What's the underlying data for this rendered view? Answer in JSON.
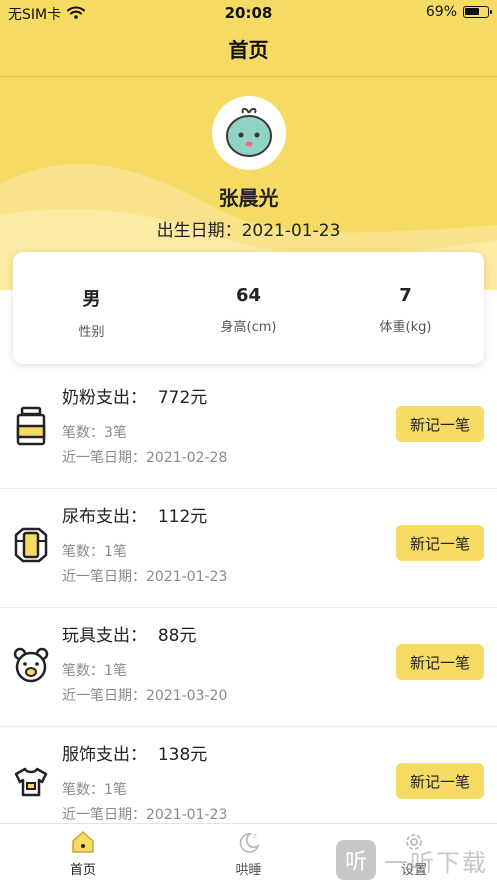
{
  "status_bar": {
    "carrier": "无SIM卡",
    "time": "20:08",
    "battery_percent": "69%",
    "battery_level": 0.69
  },
  "nav": {
    "title": "首页"
  },
  "profile": {
    "name": "张晨光",
    "birth_label": "出生日期：",
    "birth_date": "2021-01-23"
  },
  "stats": [
    {
      "value": "男",
      "label": "性别"
    },
    {
      "value": "64",
      "label": "身高(cm)"
    },
    {
      "value": "7",
      "label": "体重(kg)"
    }
  ],
  "expenses": [
    {
      "title": "奶粉支出：",
      "amount": "772元",
      "count": "笔数：3笔",
      "last_date": "近一笔日期：2021-02-28",
      "button": "新记一笔",
      "icon": "milk-can-icon"
    },
    {
      "title": "尿布支出：",
      "amount": "112元",
      "count": "笔数：1笔",
      "last_date": "近一笔日期：2021-01-23",
      "button": "新记一笔",
      "icon": "diaper-icon"
    },
    {
      "title": "玩具支出：",
      "amount": "88元",
      "count": "笔数：1笔",
      "last_date": "近一笔日期：2021-03-20",
      "button": "新记一笔",
      "icon": "bear-toy-icon"
    },
    {
      "title": "服饰支出：",
      "amount": "138元",
      "count": "笔数：1笔",
      "last_date": "近一笔日期：2021-01-23",
      "button": "新记一笔",
      "icon": "onesie-icon"
    }
  ],
  "tabs": [
    {
      "label": "首页",
      "icon": "home-icon",
      "active": true
    },
    {
      "label": "哄睡",
      "icon": "moon-sleep-icon",
      "active": false
    },
    {
      "label": "设置",
      "icon": "gear-icon",
      "active": false
    }
  ],
  "watermark": {
    "box_text": "听",
    "text": "一听下载"
  },
  "colors": {
    "accent": "#f5da63",
    "text": "#222222",
    "muted": "#8a8a8a"
  }
}
